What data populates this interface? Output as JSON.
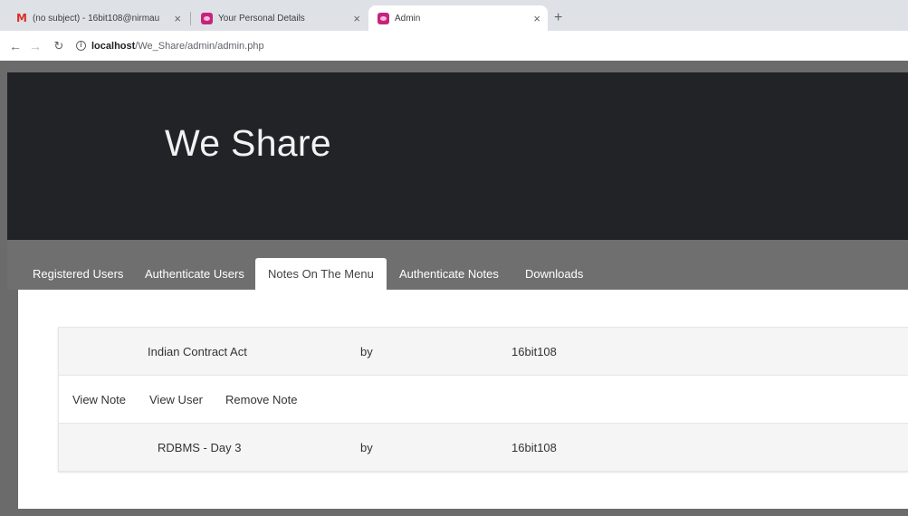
{
  "browser": {
    "tabs": [
      {
        "title": "(no subject) - 16bit108@nirmau",
        "favicon": "gmail-icon",
        "active": false
      },
      {
        "title": "Your Personal Details",
        "favicon": "owl-icon",
        "active": false
      },
      {
        "title": "Admin",
        "favicon": "owl-icon",
        "active": true
      }
    ],
    "close_glyph": "×",
    "new_tab_glyph": "+",
    "url_host": "localhost",
    "url_path": "/We_Share/admin/admin.php"
  },
  "page": {
    "brand": "We Share",
    "nav": [
      {
        "label": "Registered Users",
        "active": false
      },
      {
        "label": "Authenticate Users",
        "active": false
      },
      {
        "label": "Notes On The Menu",
        "active": true
      },
      {
        "label": "Authenticate Notes",
        "active": false
      },
      {
        "label": "Downloads",
        "active": false
      }
    ],
    "notes": [
      {
        "title": "Indian Contract Act",
        "by": "by",
        "user": "16bit108"
      },
      {
        "title": "RDBMS - Day 3",
        "by": "by",
        "user": "16bit108"
      }
    ],
    "actions": {
      "view_note": "View Note",
      "view_user": "View User",
      "remove_note": "Remove Note"
    }
  },
  "colors": {
    "header_bg": "#222326",
    "nav_bg": "#6f6f6f",
    "favicon_pink": "#c4247e",
    "gmail_red": "#d93025"
  }
}
